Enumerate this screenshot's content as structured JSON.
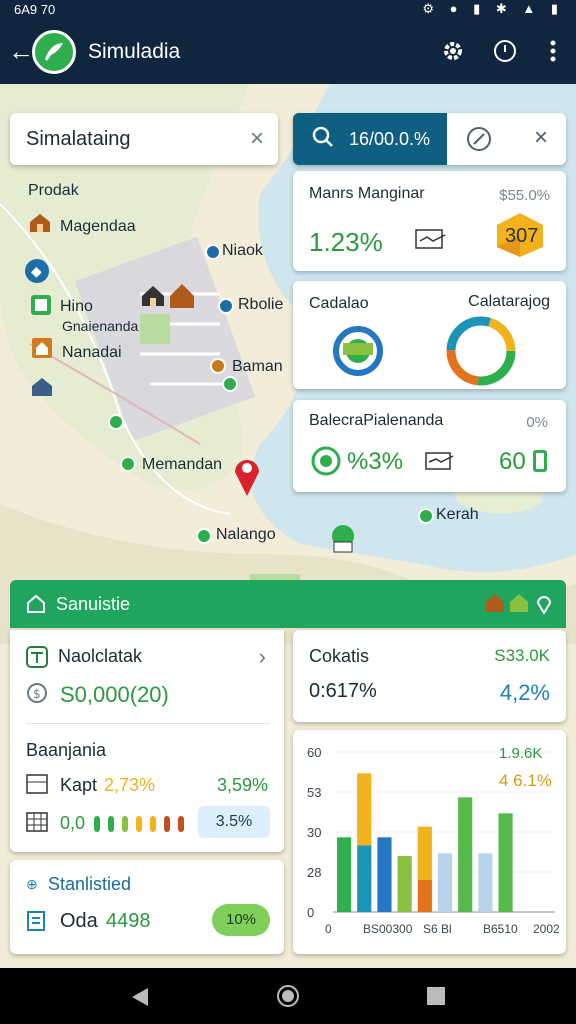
{
  "status_bar": {
    "time": "6A9 70"
  },
  "app_bar": {
    "back": "←",
    "title": "Simuladia"
  },
  "map": {
    "labels": {
      "prodak": "Prodak",
      "magendaa": "Magendaa",
      "hino": "Hino",
      "graienanda": "Gnaienanda",
      "nanadai": "Nanadai",
      "niaok": "Niaok",
      "rbolie": "Rbolie",
      "baman": "Baman",
      "memandan": "Memandan",
      "nalango": "Nalango",
      "kerah": "Kerah"
    }
  },
  "search_left": {
    "text": "Simalataing",
    "clear": "×"
  },
  "search_right": {
    "value": "16/00.0.%",
    "clear": "×"
  },
  "card_margin": {
    "title": "Manrs Manginar",
    "sub": "$55.0%",
    "value": "1.23%",
    "badge": "307"
  },
  "card_cadalao": {
    "left_title": "Cadalao",
    "right_title": "Calatarajog"
  },
  "card_bal": {
    "title": "BalecraPialenanda",
    "corner": "0%",
    "value": "%3%",
    "right": "60"
  },
  "panel": {
    "header": "Sanuistie",
    "left_card": {
      "title": "Naolclatak",
      "value": "S0,000(20)",
      "section": "Baanjania",
      "row1_label": "Kapt",
      "row1_highlight": "2,73%",
      "row1_value": "3,59%",
      "row2_label": "0,0",
      "row2_chip": "3.5%"
    },
    "right_card": {
      "title": "Cokatis",
      "title_value": "S33.0K",
      "value_left": "0:617%",
      "value_right": "4,2%"
    },
    "stats_card": {
      "title": "Stanlistied",
      "label": "Oda",
      "value": "4498",
      "badge": "10%"
    }
  },
  "chart_data": {
    "type": "bar",
    "ylim": [
      0,
      60
    ],
    "y_ticks": [
      "60",
      "53",
      "30",
      "28",
      "0"
    ],
    "x_ticks": [
      "0",
      "BS00300",
      "S6 Bl",
      "B6510",
      "2002"
    ],
    "annotations": [
      "1.9.6K",
      "4 6.1%"
    ],
    "colors": [
      "#2fb04f",
      "#f2b21c",
      "#1c93b8",
      "#2478c2",
      "#8ac040",
      "#f29f22",
      "#e4721d",
      "#b9d3ea"
    ],
    "bars": [
      {
        "value": 28,
        "stack": 0,
        "color": "#2fb04f"
      },
      {
        "value": 25,
        "stack": 0,
        "color": "#1c93b8"
      },
      {
        "value": 27,
        "stack": 25,
        "color": "#f2b21c"
      },
      {
        "value": 28,
        "stack": 0,
        "color": "#2478c2"
      },
      {
        "value": 21,
        "stack": 0,
        "color": "#8ac040"
      },
      {
        "value": 12,
        "stack": 0,
        "color": "#e4721d"
      },
      {
        "value": 20,
        "stack": 12,
        "color": "#f2b21c"
      },
      {
        "value": 22,
        "stack": 0,
        "color": "#b9d3ea"
      },
      {
        "value": 43,
        "stack": 0,
        "color": "#56b94b"
      },
      {
        "value": 22,
        "stack": 0,
        "color": "#b9d3ea"
      },
      {
        "value": 37,
        "stack": 0,
        "color": "#56b94b"
      }
    ]
  }
}
